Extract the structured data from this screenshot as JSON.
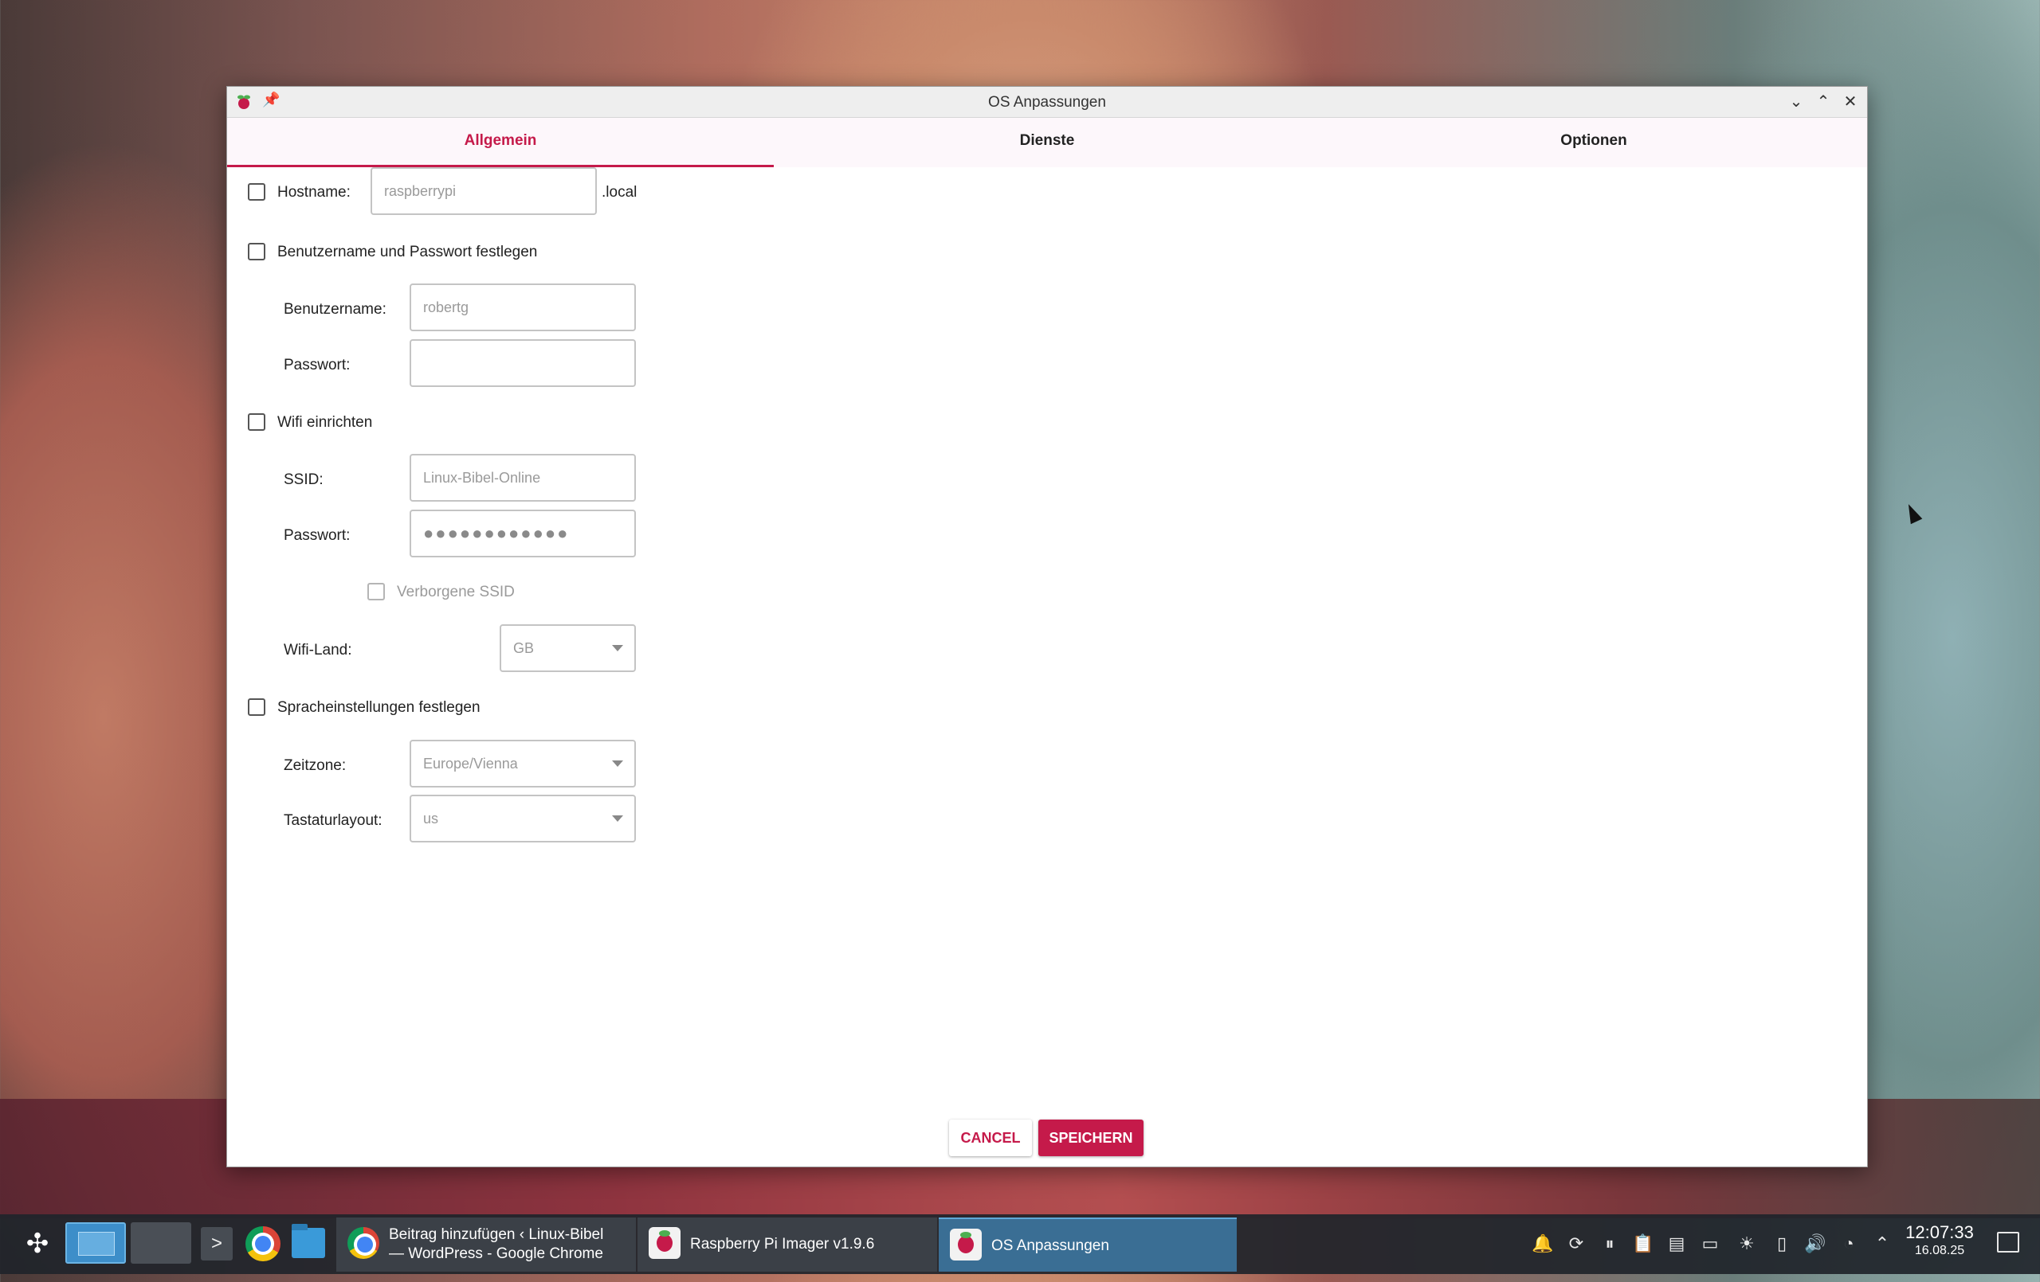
{
  "window": {
    "title": "OS Anpassungen",
    "pin_icon": "pin-icon",
    "controls": [
      "minimize-icon",
      "maximize-icon",
      "close-icon"
    ]
  },
  "tabs": [
    {
      "label": "Allgemein",
      "active": true
    },
    {
      "label": "Dienste",
      "active": false
    },
    {
      "label": "Optionen",
      "active": false
    }
  ],
  "form": {
    "hostname": {
      "label": "Hostname:",
      "placeholder": "raspberrypi",
      "suffix": ".local",
      "checked": false
    },
    "user": {
      "label": "Benutzername und Passwort festlegen",
      "checked": false,
      "username_label": "Benutzername:",
      "username_placeholder": "robertg",
      "password_label": "Passwort:",
      "password_value": ""
    },
    "wifi": {
      "label": "Wifi einrichten",
      "checked": false,
      "ssid_label": "SSID:",
      "ssid_placeholder": "Linux-Bibel-Online",
      "password_label": "Passwort:",
      "password_dots": "●●●●●●●●●●●●",
      "hidden_ssid_label": "Verborgene SSID",
      "hidden_ssid_checked": false,
      "country_label": "Wifi-Land:",
      "country_value": "GB"
    },
    "locale": {
      "label": "Spracheinstellungen festlegen",
      "checked": false,
      "timezone_label": "Zeitzone:",
      "timezone_value": "Europe/Vienna",
      "keyboard_label": "Tastaturlayout:",
      "keyboard_value": "us"
    }
  },
  "buttons": {
    "cancel": "CANCEL",
    "save": "SPEICHERN"
  },
  "taskbar": {
    "tasks": [
      {
        "line1": "Beitrag hinzufügen ‹ Linux-Bibel",
        "line2": "— WordPress - Google Chrome",
        "icon": "chrome-icon"
      },
      {
        "line1": "Raspberry Pi Imager v1.9.6",
        "icon": "raspberry-pi-icon"
      },
      {
        "line1": "OS Anpassungen",
        "icon": "raspberry-pi-icon",
        "active": true
      }
    ],
    "tray_icons": [
      "notifications-icon",
      "update-icon",
      "media-pause-icon",
      "clipboard-icon",
      "sd-card-icon",
      "display-icon",
      "brightness-icon",
      "battery-icon",
      "volume-icon",
      "wifi-icon",
      "expand-tray-icon"
    ],
    "time": "12:07:33",
    "date": "16.08.25"
  },
  "colors": {
    "accent": "#c51a4a",
    "taskbar": "#20242a",
    "active_task": "#3a6e94"
  }
}
